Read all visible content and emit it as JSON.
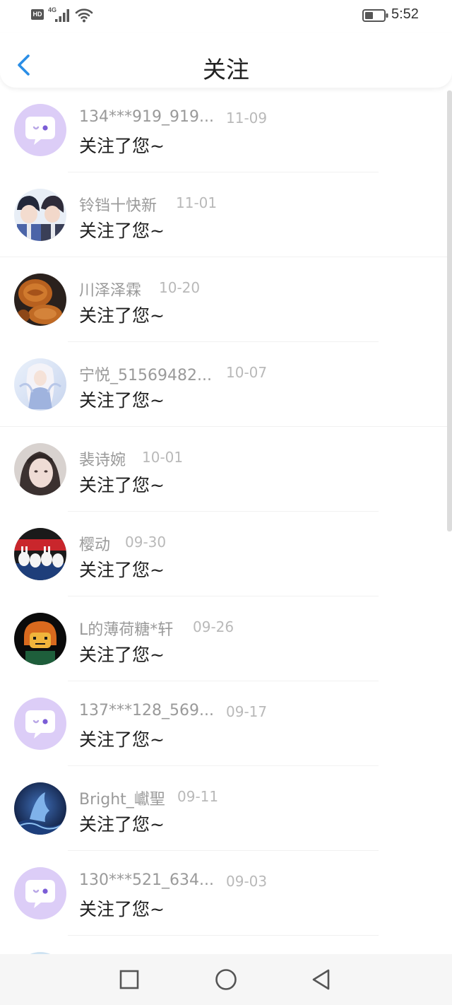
{
  "status_bar": {
    "hd_label": "HD",
    "network": "4G",
    "time": "5:52"
  },
  "header": {
    "title": "关注",
    "back_icon": "chevron-left-icon"
  },
  "items": [
    {
      "username": "134***919_919...",
      "date": "11-09",
      "message": "关注了您~",
      "avatar": "default-chat-avatar"
    },
    {
      "username": "铃铛十快新",
      "date": "11-01",
      "message": "关注了您~",
      "avatar": "anime-couple-avatar"
    },
    {
      "username": "川泽泽霖",
      "date": "10-20",
      "message": "关注了您~",
      "avatar": "mooncake-avatar"
    },
    {
      "username": "宁悦_51569482...",
      "date": "10-07",
      "message": "关注了您~",
      "avatar": "anime-girl-avatar"
    },
    {
      "username": "裴诗婉",
      "date": "10-01",
      "message": "关注了您~",
      "avatar": "girl-photo-avatar"
    },
    {
      "username": "樱动",
      "date": "09-30",
      "message": "关注了您~",
      "avatar": "rabbits-avatar"
    },
    {
      "username": "L的薄荷糖*轩",
      "date": "09-26",
      "message": "关注了您~",
      "avatar": "lego-figure-avatar"
    },
    {
      "username": "137***128_569...",
      "date": "09-17",
      "message": "关注了您~",
      "avatar": "default-chat-avatar"
    },
    {
      "username": "Bright_巘聖",
      "date": "09-11",
      "message": "关注了您~",
      "avatar": "dark-blue-art-avatar"
    },
    {
      "username": "130***521_634...",
      "date": "09-03",
      "message": "关注了您~",
      "avatar": "default-chat-avatar"
    }
  ],
  "colors": {
    "accent": "#2a8ee6",
    "default_avatar_bg": "#dccdf7",
    "username": "#9a9a9a",
    "date": "#b9b9b9",
    "message": "#1e1e1e"
  },
  "nav": {
    "buttons": [
      "square-recent-apps-icon",
      "circle-home-icon",
      "triangle-back-icon"
    ]
  }
}
